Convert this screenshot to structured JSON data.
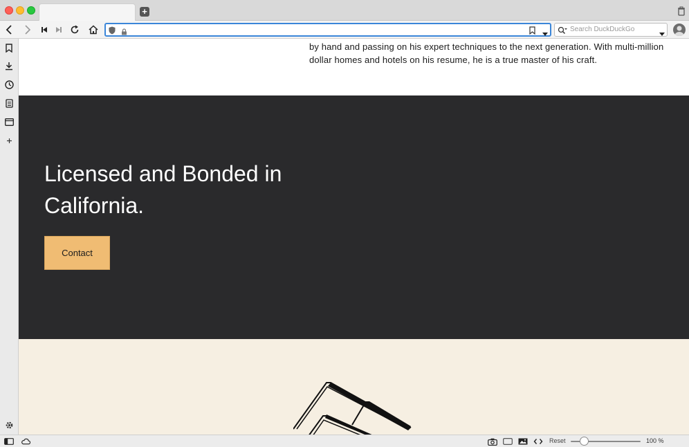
{
  "browser": {
    "tab_title": "",
    "address": "",
    "search_placeholder": "Search DuckDuckGo",
    "zoom": {
      "reset_label": "Reset",
      "value_label": "100 %",
      "level_percent": 100
    }
  },
  "page": {
    "intro_text": "by hand and passing on his expert techniques to the next generation. With multi-million dollar homes and hotels on his resume, he is a true master of his craft.",
    "license_heading": "Licensed and Bonded in California.",
    "contact_button": "Contact"
  },
  "colors": {
    "dark_section": "#2a2a2c",
    "cream_section": "#f6efe2",
    "contact_button": "#f0bc73",
    "url_focus": "#3b86d9"
  },
  "icons": {
    "back": "chevron-left-icon",
    "forward": "chevron-right-icon",
    "rewind": "skip-back-icon",
    "fastforward": "skip-forward-icon",
    "reload": "reload-icon",
    "home": "home-icon",
    "shield": "shield-icon",
    "lock": "lock-icon",
    "bookmark": "bookmark-icon",
    "downloads": "download-icon",
    "history": "clock-icon",
    "notes": "notes-icon",
    "window": "window-icon",
    "add_panel": "plus-icon",
    "settings": "gear-icon",
    "panel_toggle": "panel-toggle-icon",
    "sync": "cloud-icon",
    "capture": "camera-icon",
    "tiling": "tiling-icon",
    "images": "image-icon",
    "devtools": "code-icon",
    "trash": "trash-icon",
    "logo": "roof-logo"
  }
}
